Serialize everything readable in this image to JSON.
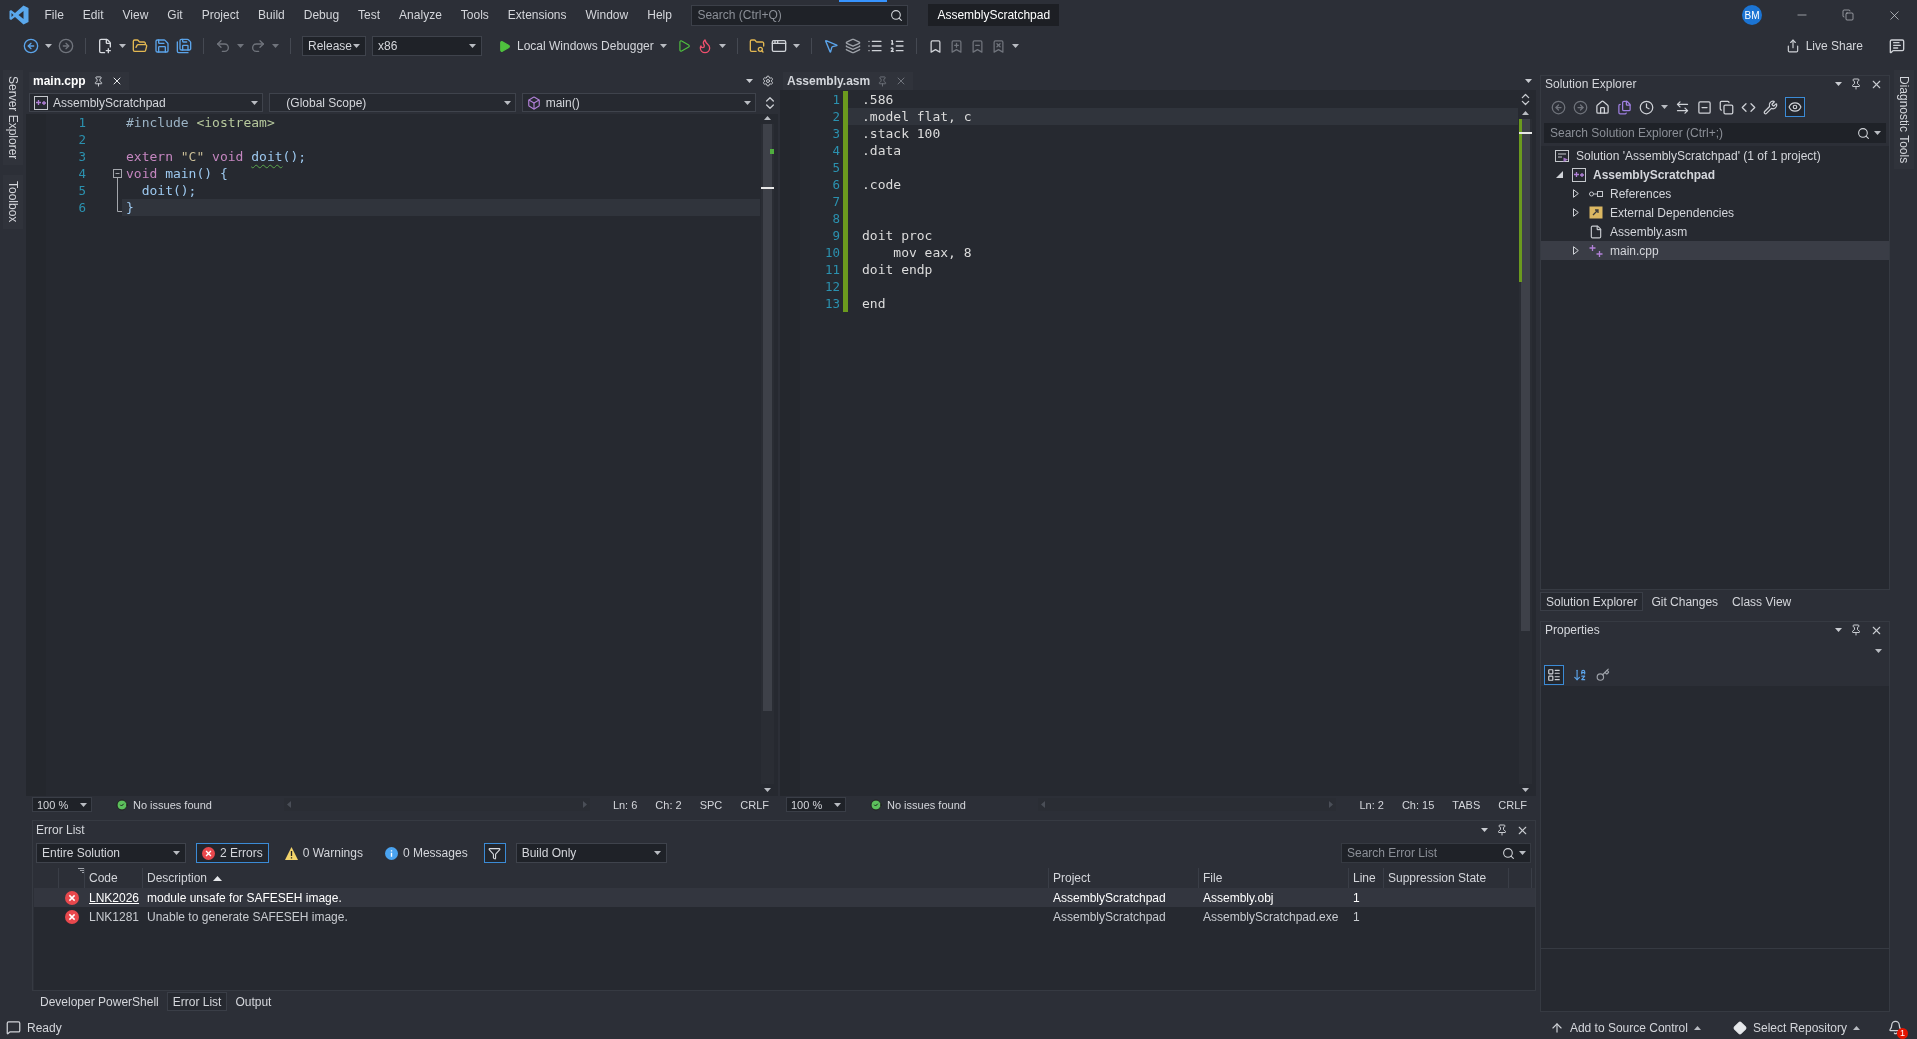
{
  "title_bar": {
    "menu": [
      "File",
      "Edit",
      "View",
      "Git",
      "Project",
      "Build",
      "Debug",
      "Test",
      "Analyze",
      "Tools",
      "Extensions",
      "Window",
      "Help"
    ],
    "search": {
      "placeholder": "Search (Ctrl+Q)"
    },
    "solution_name": "AssemblyScratchpad",
    "avatar": "BM"
  },
  "toolbar": {
    "configuration": "Release",
    "platform": "x86",
    "debugger": "Local Windows Debugger",
    "live_share": "Live Share"
  },
  "left_dock_tabs": [
    "Server Explorer",
    "Toolbox"
  ],
  "editors": [
    {
      "tab": {
        "title": "main.cpp",
        "selected": true
      },
      "nav_bar": {
        "project": "AssemblyScratchpad",
        "scope": "(Global Scope)",
        "member": "main()"
      },
      "lines": [
        {
          "number": "1",
          "kind": "plain",
          "changed": false,
          "current": false,
          "tokens": [
            {
              "text": "#include",
              "kind": "preprocessor"
            },
            {
              "text": " <iostream>",
              "kind": "include"
            }
          ]
        },
        {
          "number": "2",
          "kind": "plain",
          "changed": false,
          "current": false
        },
        {
          "number": "3",
          "kind": "plain",
          "changed": false,
          "current": false,
          "tokens": [
            {
              "text": "extern",
              "kind": "keyword"
            },
            {
              "text": " \"C\" ",
              "kind": "string"
            },
            {
              "text": "void ",
              "kind": "keyword"
            },
            {
              "text": "doit",
              "kind": "function_warning"
            },
            {
              "text": "();",
              "kind": "punctuation"
            }
          ]
        },
        {
          "number": "4",
          "kind": "fold_start",
          "changed": false,
          "current": false,
          "tokens": [
            {
              "text": "void",
              "kind": "keyword"
            },
            {
              "text": " main",
              "kind": "function"
            },
            {
              "text": "() {",
              "kind": "punctuation"
            }
          ]
        },
        {
          "number": "5",
          "kind": "fold_body",
          "changed": false,
          "current": false,
          "tokens": [
            {
              "text": "  doit",
              "kind": "function"
            },
            {
              "text": "();",
              "kind": "punctuation"
            }
          ]
        },
        {
          "number": "6",
          "kind": "fold_end",
          "changed": false,
          "current": true,
          "tokens": [
            {
              "text": "}",
              "kind": "punctuation"
            }
          ]
        }
      ],
      "status": {
        "zoom": "100 %",
        "issues": "No issues found",
        "line": "Ln: 6",
        "column": "Ch: 2",
        "whitespace": "SPC",
        "line_ending": "CRLF"
      }
    },
    {
      "tab": {
        "title": "Assembly.asm",
        "selected": false
      },
      "lines": [
        {
          "number": "1",
          "changed": true,
          "current": false,
          "tokens": [
            {
              "text": ".586",
              "kind": "plain"
            }
          ]
        },
        {
          "number": "2",
          "changed": true,
          "current": true,
          "tokens": [
            {
              "text": ".model flat, c",
              "kind": "plain"
            }
          ]
        },
        {
          "number": "3",
          "changed": true,
          "current": false,
          "tokens": [
            {
              "text": ".stack 100",
              "kind": "plain"
            }
          ]
        },
        {
          "number": "4",
          "changed": true,
          "current": false,
          "tokens": [
            {
              "text": ".data",
              "kind": "plain"
            }
          ]
        },
        {
          "number": "5",
          "changed": true,
          "current": false
        },
        {
          "number": "6",
          "changed": true,
          "current": false,
          "tokens": [
            {
              "text": ".code",
              "kind": "plain"
            }
          ]
        },
        {
          "number": "7",
          "changed": true,
          "current": false
        },
        {
          "number": "8",
          "changed": true,
          "current": false
        },
        {
          "number": "9",
          "changed": true,
          "current": false,
          "tokens": [
            {
              "text": "doit proc",
              "kind": "plain"
            }
          ]
        },
        {
          "number": "10",
          "changed": true,
          "current": false,
          "tokens": [
            {
              "text": "    mov eax, 8",
              "kind": "plain"
            }
          ]
        },
        {
          "number": "11",
          "changed": true,
          "current": false,
          "tokens": [
            {
              "text": "doit endp",
              "kind": "plain"
            }
          ]
        },
        {
          "number": "12",
          "changed": true,
          "current": false
        },
        {
          "number": "13",
          "changed": true,
          "current": false,
          "tokens": [
            {
              "text": "end",
              "kind": "plain"
            }
          ]
        }
      ],
      "status": {
        "zoom": "100 %",
        "issues": "No issues found",
        "line": "Ln: 2",
        "column": "Ch: 15",
        "whitespace": "TABS",
        "line_ending": "CRLF"
      }
    }
  ],
  "solution_explorer": {
    "title": "Solution Explorer",
    "preview_toggle": {
      "on": true
    },
    "search": {
      "placeholder": "Search Solution Explorer (Ctrl+;)"
    },
    "tree": [
      {
        "label": "Solution 'AssemblyScratchpad' (1 of 1 project)",
        "kind": "solution",
        "selected": false,
        "children": [
          {
            "label": "AssemblyScratchpad",
            "kind": "project",
            "expanded": true,
            "selected": false,
            "children": [
              {
                "label": "References",
                "kind": "references",
                "expanded": false,
                "selected": false
              },
              {
                "label": "External Dependencies",
                "kind": "external",
                "expanded": false,
                "selected": false
              },
              {
                "label": "Assembly.asm",
                "kind": "asm_file",
                "selected": false
              },
              {
                "label": "main.cpp",
                "kind": "cpp_file",
                "expanded": false,
                "selected": true
              }
            ]
          }
        ]
      }
    ],
    "tabs": [
      {
        "label": "Solution Explorer",
        "selected": true
      },
      {
        "label": "Git Changes",
        "selected": false
      },
      {
        "label": "Class View",
        "selected": false
      }
    ]
  },
  "properties": {
    "title": "Properties",
    "view_modes": [
      {
        "kind": "categorized",
        "selected": true
      },
      {
        "kind": "alphabetical",
        "selected": false
      }
    ]
  },
  "right_dock_tabs": [
    "Diagnostic Tools"
  ],
  "error_list": {
    "title": "Error List",
    "scope": "Entire Solution",
    "filters": [
      {
        "label": "2 Errors",
        "kind": "error",
        "selected": true
      },
      {
        "label": "0 Warnings",
        "kind": "warning",
        "selected": false
      },
      {
        "label": "0 Messages",
        "kind": "message",
        "selected": false
      }
    ],
    "filter_toggle": {
      "on": true
    },
    "source": "Build Only",
    "search": {
      "placeholder": "Search Error List"
    },
    "columns": [
      {
        "label": "Code",
        "sorted": false
      },
      {
        "label": "Description",
        "sorted": true
      },
      {
        "label": "Project",
        "sorted": false
      },
      {
        "label": "File",
        "sorted": false
      },
      {
        "label": "Line",
        "sorted": false
      },
      {
        "label": "Suppression State",
        "sorted": false
      }
    ],
    "rows": [
      {
        "kind": "error",
        "code": "LNK2026",
        "code_link": true,
        "description": "module unsafe for SAFESEH image.",
        "project": "AssemblyScratchpad",
        "file": "Assembly.obj",
        "line": "1",
        "selected": true
      },
      {
        "kind": "error",
        "code": "LNK1281",
        "code_link": false,
        "description": "Unable to generate SAFESEH image.",
        "project": "AssemblyScratchpad",
        "file": "AssemblyScratchpad.exe",
        "line": "1",
        "selected": false
      }
    ]
  },
  "bottom_tabs": [
    {
      "label": "Developer PowerShell",
      "selected": false
    },
    {
      "label": "Error List",
      "selected": true
    },
    {
      "label": "Output",
      "selected": false
    }
  ],
  "status_bar": {
    "status": "Ready",
    "source_control": "Add to Source Control",
    "repository": "Select Repository",
    "notifications": "1"
  }
}
